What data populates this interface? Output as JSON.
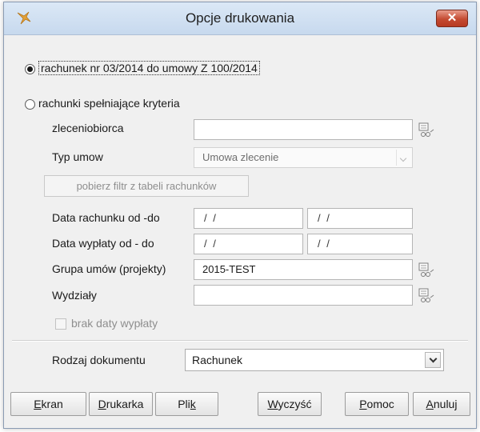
{
  "window": {
    "title": "Opcje drukowania",
    "close_label": "✕"
  },
  "options": {
    "selected": "single",
    "single_label": "rachunek nr 03/2014 do umowy Z 100/2014",
    "criteria_label": "rachunki spełniające kryteria"
  },
  "criteria": {
    "contractor_label": "zleceniobiorca",
    "contractor_value": "",
    "contract_type_label": "Typ umow",
    "contract_type_value": "Umowa zlecenie",
    "filter_button": "pobierz filtr z tabeli rachunków",
    "invoice_date_label": "Data rachunku od -do",
    "invoice_date_from": "/ /",
    "invoice_date_to": "/ /",
    "payout_date_label": "Data wypłaty od - do",
    "payout_date_from": "/ /",
    "payout_date_to": "/ /",
    "group_label": "Grupa umów (projekty)",
    "group_value": "2015-TEST",
    "departments_label": "Wydziały",
    "departments_value": "",
    "no_payout_date_label": "brak daty wypłaty",
    "no_payout_date_checked": false
  },
  "document": {
    "label": "Rodzaj dokumentu",
    "value": "Rachunek"
  },
  "buttons": {
    "screen_hot": "E",
    "screen_rest": "kran",
    "printer_hot": "D",
    "printer_rest": "rukarka",
    "file_pre": "Pli",
    "file_hot": "k",
    "clear_hot": "W",
    "clear_rest": "yczyść",
    "help_hot": "P",
    "help_rest": "omoc",
    "cancel_hot": "A",
    "cancel_rest": "nuluj"
  },
  "colors": {
    "titlebar": "#c7d9ee",
    "close": "#c44b32",
    "dialog": "#f0f0f0"
  }
}
